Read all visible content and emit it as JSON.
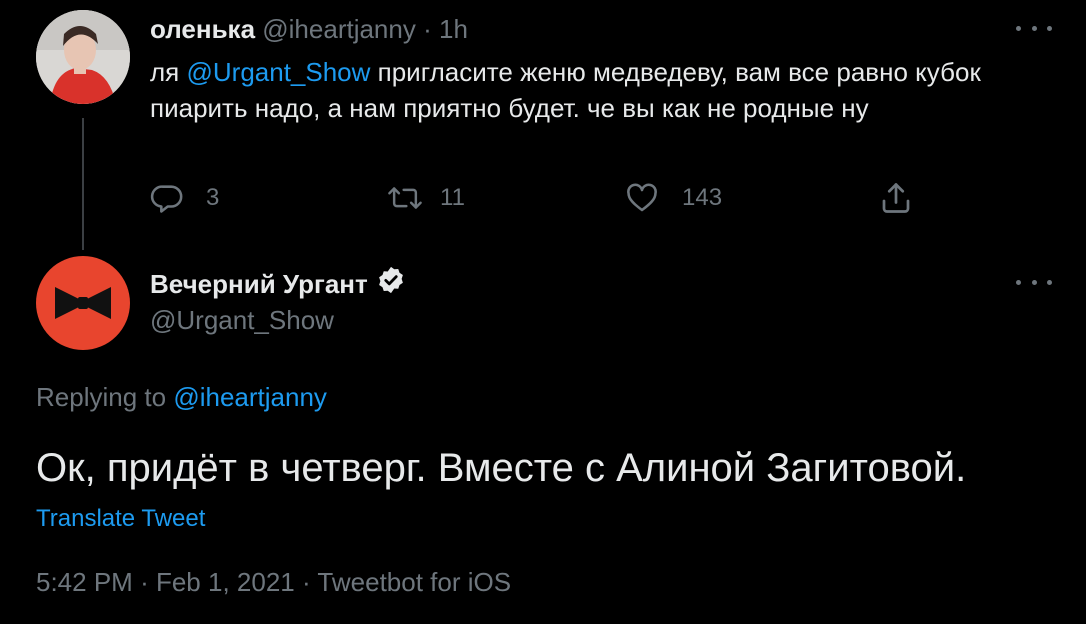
{
  "parent_tweet": {
    "avatar": "user-avatar-photo",
    "display_name": "оленька",
    "handle": "@iheartjanny",
    "separator": "·",
    "time": "1h",
    "text_prefix": "ля ",
    "mention": "@Urgant_Show",
    "text_rest": " пригласите женю медведеву, вам все равно кубок пиарить надо, а нам приятно будет. че вы как не родные ну",
    "actions": {
      "reply_count": "3",
      "retweet_count": "11",
      "like_count": "143"
    }
  },
  "main_tweet": {
    "avatar": "bow-tie-logo",
    "display_name": "Вечерний Ургант",
    "verified": true,
    "handle": "@Urgant_Show",
    "replying_label": "Replying to",
    "replying_to": "@iheartjanny",
    "text": "Ок, придёт в четверг. Вместе с Алиной Загитовой.",
    "translate_label": "Translate Tweet",
    "time": "5:42 PM",
    "date": "Feb 1, 2021",
    "source": "Tweetbot for iOS",
    "separator": "·"
  },
  "colors": {
    "background": "#000000",
    "text": "#e7e9ea",
    "secondary": "#6e767d",
    "link": "#1d9bf0",
    "avatar_red": "#e8452e"
  }
}
